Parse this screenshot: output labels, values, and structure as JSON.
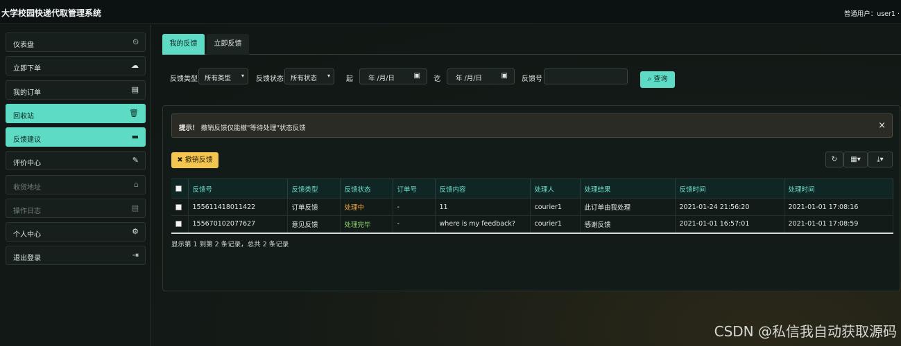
{
  "app": {
    "title": "大学校园快递代取管理系统",
    "user_info": "普通用户：user1 ·"
  },
  "sidebar": {
    "items": [
      {
        "label": "仪表盘",
        "icon": "⏲"
      },
      {
        "label": "立即下单",
        "icon": "☁"
      },
      {
        "label": "我的订单",
        "icon": "▤"
      },
      {
        "label": "回收站",
        "icon": "🗑"
      },
      {
        "label": "反馈建议",
        "icon": "▬"
      },
      {
        "label": "评价中心",
        "icon": "✎"
      },
      {
        "label": "收货地址",
        "icon": "⌂"
      },
      {
        "label": "操作日志",
        "icon": "▤"
      },
      {
        "label": "个人中心",
        "icon": "⚙"
      },
      {
        "label": "退出登录",
        "icon": "⇥"
      }
    ]
  },
  "tabs": {
    "active": "我的反馈",
    "inactive": "立即反馈"
  },
  "filters": {
    "type_label": "反馈类型",
    "type_value": "所有类型",
    "status_label": "反馈状态",
    "status_value": "所有状态",
    "from_label": "起",
    "from_value": "年 /月/日",
    "to_label": "讫",
    "to_value": "年 /月/日",
    "id_label": "反馈号",
    "id_value": "",
    "query_label": "查询"
  },
  "alert": {
    "prefix": "提示！",
    "text": " 撤销反馈仅能撤\"等待处理\"状态反馈",
    "close": "×"
  },
  "toolbar": {
    "revoke_label": "撤销反馈",
    "refresh_icon": "refresh-icon",
    "columns_icon": "columns-icon",
    "export_icon": "export-icon"
  },
  "table": {
    "headers": [
      "反馈号",
      "反馈类型",
      "反馈状态",
      "订单号",
      "反馈内容",
      "处理人",
      "处理结果",
      "反馈时间",
      "处理时间"
    ],
    "rows": [
      [
        "155611418011422",
        "订单反馈",
        "处理中",
        "-",
        "11",
        "courier1",
        "此订单由我处理",
        "2021-01-24 21:56:20",
        "2021-01-01 17:08:16"
      ],
      [
        "155670102077627",
        "意见反馈",
        "处理完毕",
        "-",
        "where is my feedback?",
        "courier1",
        "感谢反馈",
        "2021-01-01 16:57:01",
        "2021-01-01 17:08:59"
      ]
    ],
    "status_colors": {
      "处理中": "#f0a641",
      "处理完毕": "#8ed46f"
    }
  },
  "pager": {
    "text": "显示第 1 到第 2 条记录，总共 2 条记录"
  },
  "watermark": "CSDN @私信我自动获取源码"
}
